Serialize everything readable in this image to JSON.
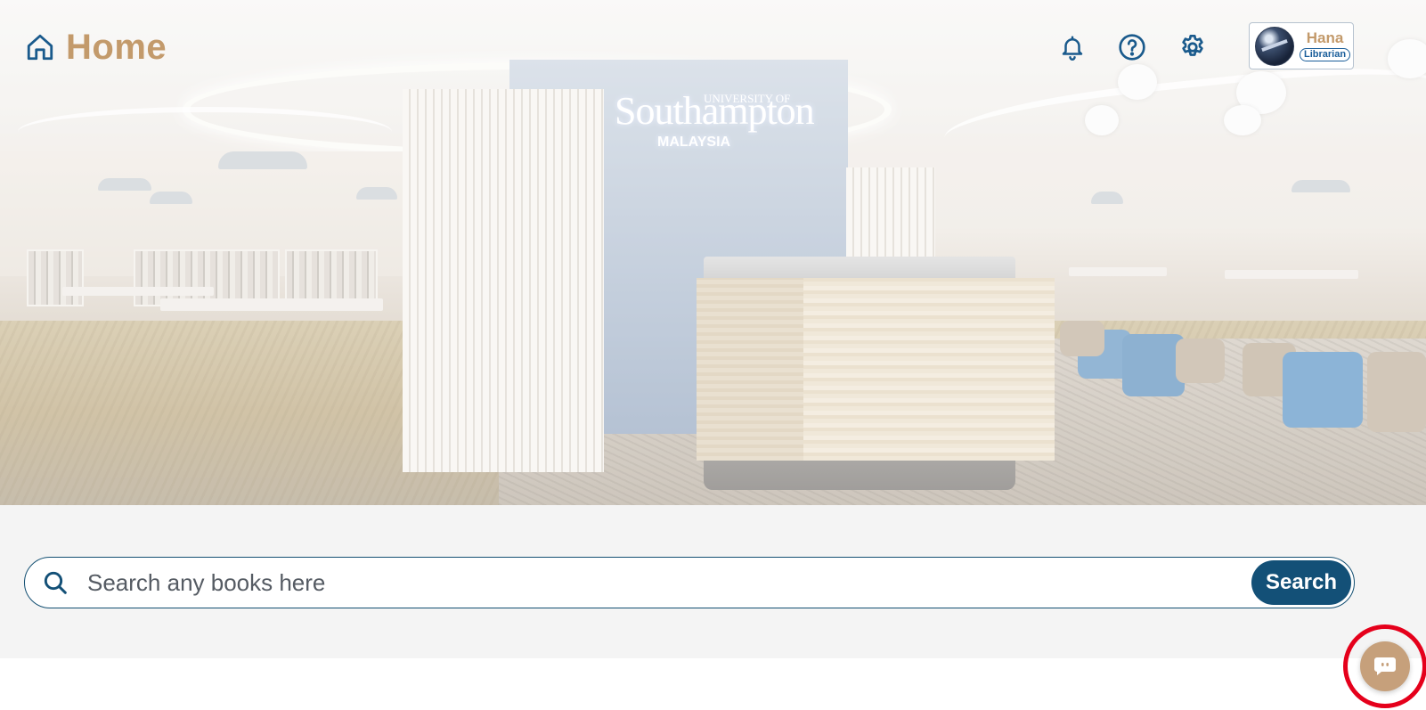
{
  "header": {
    "title": "Home",
    "icons": [
      "home-icon",
      "bell-icon",
      "help-icon",
      "gear-icon"
    ]
  },
  "hero": {
    "sign_line1": "UNIVERSITY OF",
    "sign_line2": "Southampton",
    "sign_line3": "MALAYSIA"
  },
  "profile": {
    "name": "Hana",
    "role": "Librarian"
  },
  "search": {
    "placeholder": "Search any books here",
    "button_label": "Search"
  },
  "chat": {
    "icon": "chat-icon"
  },
  "colors": {
    "primary": "#135077",
    "accent": "#c39a6b",
    "highlight_ring": "#e5001b"
  }
}
